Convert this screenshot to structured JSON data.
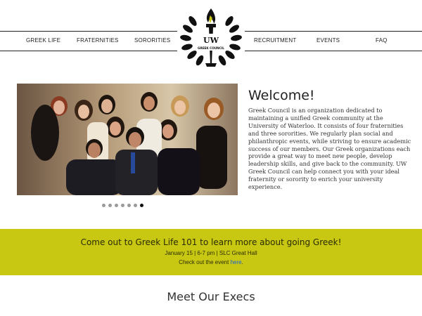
{
  "nav": {
    "left": [
      "GREEK LIFE",
      "FRATERNITIES",
      "SORORITIES"
    ],
    "right": [
      "RECRUITMENT",
      "EVENTS",
      "FAQ"
    ]
  },
  "logo": {
    "line1": "UW",
    "line2": "GREEK COUNCIL",
    "icon": "torch-laurel-wreath"
  },
  "carousel": {
    "slide_count": 7,
    "active_index": 6
  },
  "welcome": {
    "title": "Welcome!",
    "body": "Greek Council is an organization dedicated to maintaining a unified Greek community at the University of Waterloo. It consists of four fraternities and three sororities. We regularly plan social and philanthropic events, while striving to ensure academic success of our members. Our Greek organizations each provide a great way to meet new people, develop leadership skills, and give back to the community. UW Greek Council can help connect you with your ideal fraternity or sorority to enrich your university experience."
  },
  "banner": {
    "heading": "Come out to Greek Life 101 to learn more about going Greek!",
    "details": "January 15 | 6-7 pm | SLC Great Hall",
    "check_prefix": "Check out the event ",
    "link_text": "here",
    "check_suffix": ".",
    "bg_color": "#c8c812",
    "link_color": "#1a5fd0"
  },
  "execs": {
    "title": "Meet Our Execs"
  }
}
